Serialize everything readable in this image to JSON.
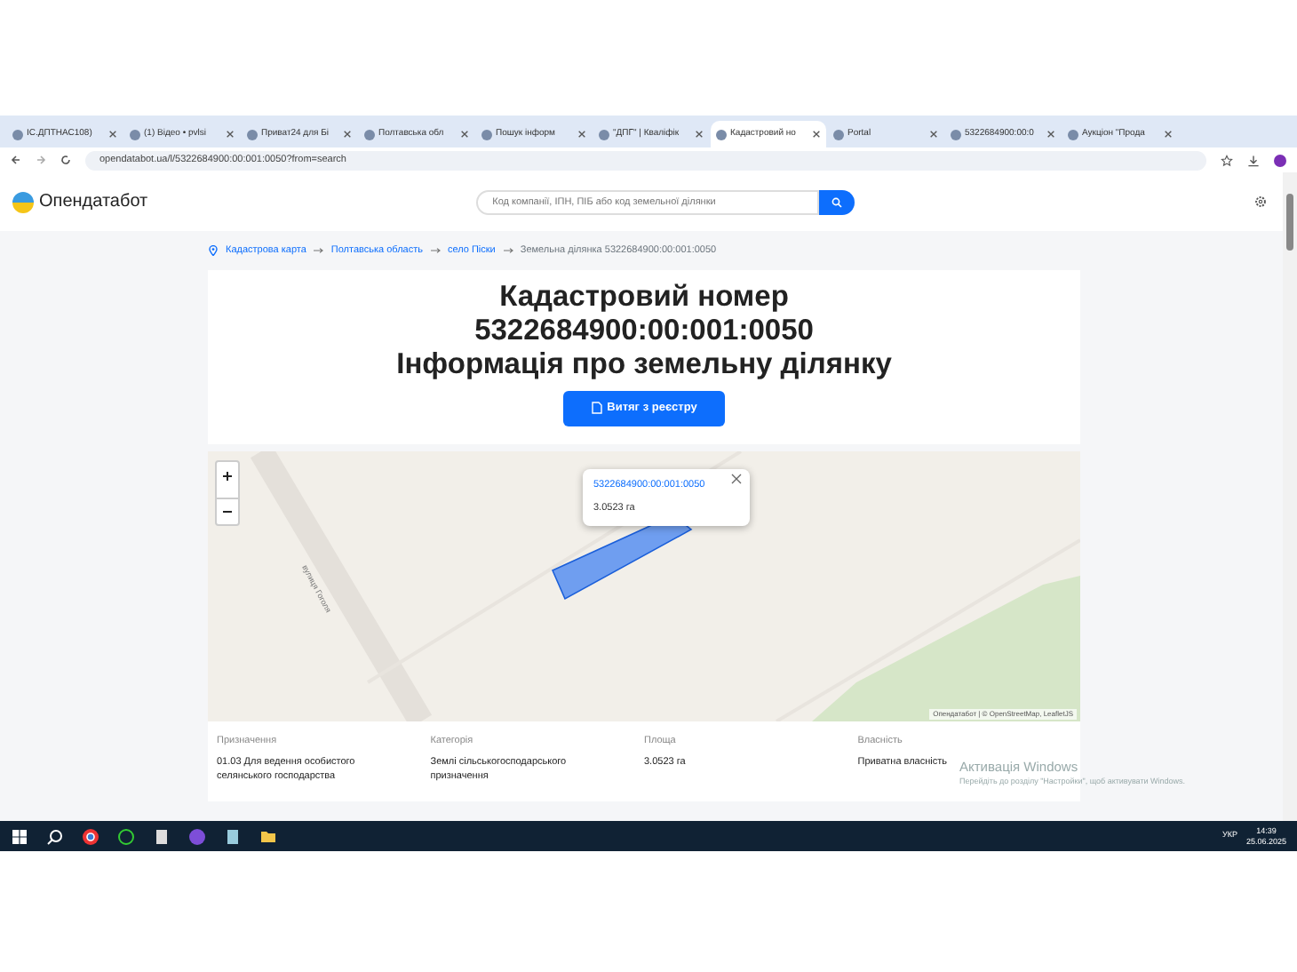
{
  "browser": {
    "tabs": [
      {
        "title": "ІС.ДПТНАС108)",
        "selected": false
      },
      {
        "title": "(1) Відео • pvlsi",
        "selected": false
      },
      {
        "title": "Приват24 для Бі",
        "selected": false
      },
      {
        "title": "Полтавська обл",
        "selected": false
      },
      {
        "title": "Пошук інформ",
        "selected": false
      },
      {
        "title": "\"ДПГ\" | Кваліфік",
        "selected": false
      },
      {
        "title": "Кадастровий но",
        "selected": true
      },
      {
        "title": "Portal",
        "selected": false
      },
      {
        "title": "5322684900:00:0",
        "selected": false
      },
      {
        "title": "Аукціон \"Прода",
        "selected": false
      }
    ],
    "url": "opendatabot.ua/l/5322684900:00:001:0050?from=search"
  },
  "site": {
    "logo": "Опендатабот",
    "search": {
      "placeholder": "Код компанії, ІПН, ПІБ або код земельної ділянки"
    }
  },
  "breadcrumb": [
    {
      "label": "Кадастрова карта",
      "link": true
    },
    {
      "label": "Полтавська область",
      "link": true
    },
    {
      "label": "село Піски",
      "link": true
    },
    {
      "label": "Земельна ділянка 5322684900:00:001:0050",
      "link": false
    }
  ],
  "heading": [
    "Кадастровий номер",
    "5322684900:00:001:0050",
    "Інформація про земельну ділянку"
  ],
  "extract_button": "Витяг з реєстру",
  "map": {
    "road_label": "вулиця Гоголя",
    "popup": {
      "title": "5322684900:00:001:0050",
      "area": "3.0523 га"
    },
    "attribution": "Опендатабот | © OpenStreetMap, LeafletJS"
  },
  "details": [
    {
      "label": "Призначення",
      "value": "01.03 Для ведення особистого селянського господарства"
    },
    {
      "label": "Категорія",
      "value": "Землі сільськогосподарського призначення"
    },
    {
      "label": "Площа",
      "value": "3.0523 га"
    },
    {
      "label": "Власність",
      "value": "Приватна власність"
    }
  ],
  "activation": {
    "title": "Активація Windows",
    "text": "Перейдіть до розділу \"Настройки\", щоб активувати Windows."
  },
  "taskbar": {
    "language": "УКР",
    "time": "14:39",
    "date": "25.06.2025"
  }
}
